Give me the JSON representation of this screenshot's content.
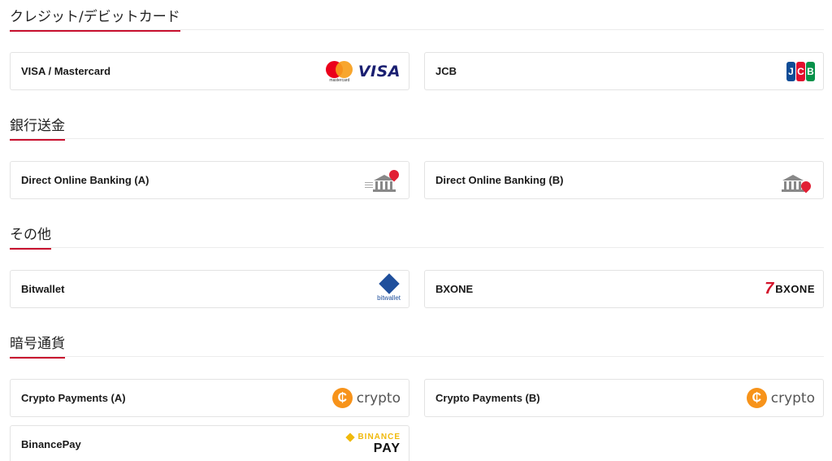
{
  "sections": {
    "cards": {
      "title": "クレジット/デビットカード",
      "items": [
        {
          "label": "VISA / Mastercard",
          "logo": "visa-mastercard-logo",
          "logo_sub": "mastercard",
          "logo_text": "VISA"
        },
        {
          "label": "JCB",
          "logo": "jcb-logo",
          "logo_text": [
            "J",
            "C",
            "B"
          ]
        }
      ]
    },
    "bank": {
      "title": "銀行送金",
      "items": [
        {
          "label": "Direct Online Banking (A)",
          "logo": "bank-pin-icon"
        },
        {
          "label": "Direct Online Banking (B)",
          "logo": "bank-pin-icon"
        }
      ]
    },
    "other": {
      "title": "その他",
      "items": [
        {
          "label": "Bitwallet",
          "logo": "bitwallet-logo",
          "logo_text": "bitwallet"
        },
        {
          "label": "BXONE",
          "logo": "bxone-logo",
          "logo_text": "BXONE"
        }
      ]
    },
    "crypto": {
      "title": "暗号通貨",
      "items": [
        {
          "label": "Crypto Payments (A)",
          "logo": "crypto-logo",
          "logo_text": "crypto"
        },
        {
          "label": "Crypto Payments (B)",
          "logo": "crypto-logo",
          "logo_text": "crypto"
        },
        {
          "label": "BinancePay",
          "logo": "binance-pay-logo",
          "logo_text": "BINANCE",
          "logo_sub": "PAY"
        }
      ]
    }
  },
  "colors": {
    "accent_underline": "#c8102e",
    "mastercard_red": "#eb001b",
    "mastercard_orange": "#f79e1b",
    "visa_blue": "#1a1f71",
    "crypto_orange": "#f7931a",
    "binance_yellow": "#f0b90b",
    "bitwallet_blue": "#1f4f9c",
    "bxone_red": "#d3122a"
  }
}
